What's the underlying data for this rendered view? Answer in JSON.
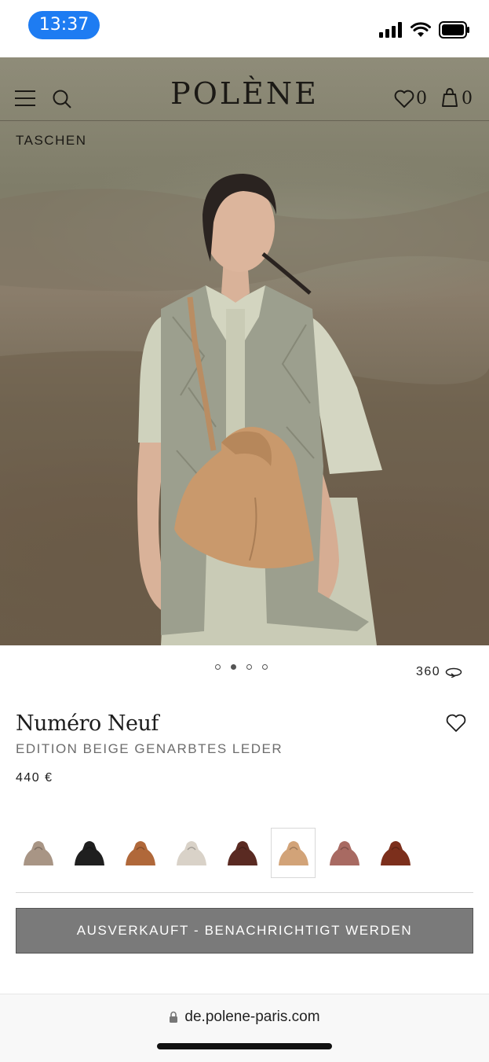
{
  "status_bar": {
    "time": "13:37"
  },
  "nav": {
    "brand": "POLÈNE",
    "wishlist_count": "0",
    "cart_count": "0",
    "breadcrumb": "TASCHEN"
  },
  "gallery": {
    "dots": 4,
    "active_dot": 1,
    "view_360_label": "360"
  },
  "product": {
    "name": "Numéro Neuf",
    "edition": "EDITION BEIGE GENARBTES LEDER",
    "price": "440 €"
  },
  "swatches": [
    {
      "name": "taupe",
      "color": "#a89585"
    },
    {
      "name": "black",
      "color": "#1f1f1f"
    },
    {
      "name": "camel",
      "color": "#b0683a"
    },
    {
      "name": "chalk",
      "color": "#d9d2c8"
    },
    {
      "name": "chocolate",
      "color": "#5a2a22"
    },
    {
      "name": "beige",
      "color": "#d2a378",
      "selected": true
    },
    {
      "name": "rosewood",
      "color": "#a86a62"
    },
    {
      "name": "cognac",
      "color": "#7c2f1c"
    }
  ],
  "cta": {
    "label": "AUSVERKAUFT - BENACHRICHTIGT WERDEN"
  },
  "browser": {
    "url": "de.polene-paris.com"
  }
}
